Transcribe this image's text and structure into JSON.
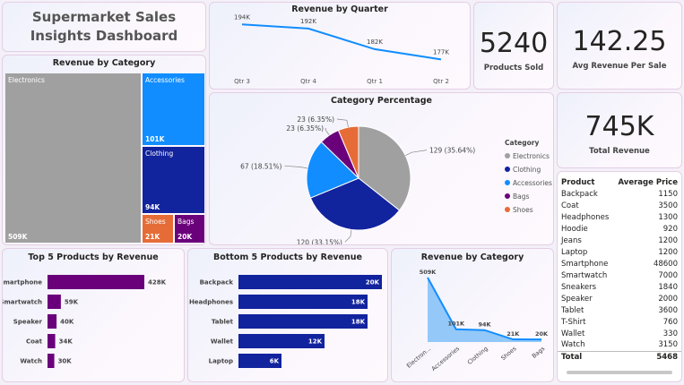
{
  "title": "Supermarket Sales Insights Dashboard",
  "kpis": {
    "products_sold": {
      "value": "5240",
      "label": "Products Sold"
    },
    "avg_revenue": {
      "value": "142.25",
      "label": "Avg Revenue Per Sale"
    },
    "total_revenue": {
      "value": "745K",
      "label": "Total Revenue"
    }
  },
  "colors": {
    "purple": "#6b007b",
    "navy": "#12239e",
    "grey": "#a0a0a0",
    "blue": "#118dff",
    "orange": "#e66c37",
    "light_blue": "#93c8f8"
  },
  "chart_data": [
    {
      "id": "revenue_by_quarter",
      "type": "line",
      "title": "Revenue by Quarter",
      "categories": [
        "Qtr 3",
        "Qtr 4",
        "Qtr 1",
        "Qtr 2"
      ],
      "values": [
        194,
        192,
        182,
        177
      ],
      "labels": [
        "194K",
        "192K",
        "182K",
        "177K"
      ]
    },
    {
      "id": "revenue_by_category_treemap",
      "type": "treemap",
      "title": "Revenue by Category",
      "items": [
        {
          "name": "Electronics",
          "value": 509,
          "label": "509K",
          "color": "#a0a0a0"
        },
        {
          "name": "Accessories",
          "value": 101,
          "label": "101K",
          "color": "#118dff"
        },
        {
          "name": "Clothing",
          "value": 94,
          "label": "94K",
          "color": "#12239e"
        },
        {
          "name": "Shoes",
          "value": 21,
          "label": "21K",
          "color": "#e66c37"
        },
        {
          "name": "Bags",
          "value": 20,
          "label": "20K",
          "color": "#6b007b"
        }
      ]
    },
    {
      "id": "category_percentage",
      "type": "pie",
      "title": "Category Percentage",
      "legend_title": "Category",
      "slices": [
        {
          "name": "Electronics",
          "value": 129,
          "label": "129 (35.64%)",
          "color": "#a0a0a0"
        },
        {
          "name": "Clothing",
          "value": 120,
          "label": "120 (33.15%)",
          "color": "#12239e"
        },
        {
          "name": "Accessories",
          "value": 67,
          "label": "67 (18.51%)",
          "color": "#118dff"
        },
        {
          "name": "Bags",
          "value": 23,
          "label": "23 (6.35%)",
          "color": "#6b007b"
        },
        {
          "name": "Shoes",
          "value": 23,
          "label": "23 (6.35%)",
          "color": "#e66c37"
        }
      ]
    },
    {
      "id": "top5_products",
      "type": "bar",
      "title": "Top 5 Products by Revenue",
      "categories": [
        "Smartphone",
        "Smartwatch",
        "Speaker",
        "Coat",
        "Watch"
      ],
      "values": [
        428,
        59,
        40,
        34,
        30
      ],
      "labels": [
        "428K",
        "59K",
        "40K",
        "34K",
        "30K"
      ],
      "color": "#6b007b"
    },
    {
      "id": "bottom5_products",
      "type": "bar",
      "title": "Bottom 5 Products by Revenue",
      "categories": [
        "Backpack",
        "Headphones",
        "Tablet",
        "Wallet",
        "Laptop"
      ],
      "values": [
        20,
        18,
        18,
        12,
        6
      ],
      "labels": [
        "20K",
        "18K",
        "18K",
        "12K",
        "6K"
      ],
      "color": "#12239e"
    },
    {
      "id": "revenue_by_category_area",
      "type": "area",
      "title": "Revenue by Category",
      "categories": [
        "Electron...",
        "Accessories",
        "Clothing",
        "Shoes",
        "Bags"
      ],
      "values": [
        509,
        101,
        94,
        21,
        20
      ],
      "labels": [
        "509K",
        "101K",
        "94K",
        "21K",
        "20K"
      ]
    }
  ],
  "table": {
    "headers": [
      "Product",
      "Average Price"
    ],
    "rows": [
      [
        "Backpack",
        "1150"
      ],
      [
        "Coat",
        "3500"
      ],
      [
        "Headphones",
        "1300"
      ],
      [
        "Hoodie",
        "920"
      ],
      [
        "Jeans",
        "1200"
      ],
      [
        "Laptop",
        "1200"
      ],
      [
        "Smartphone",
        "48600"
      ],
      [
        "Smartwatch",
        "7000"
      ],
      [
        "Sneakers",
        "1840"
      ],
      [
        "Speaker",
        "2000"
      ],
      [
        "Tablet",
        "3600"
      ],
      [
        "T-Shirt",
        "760"
      ],
      [
        "Wallet",
        "330"
      ],
      [
        "Watch",
        "3150"
      ]
    ],
    "total": [
      "Total",
      "5468"
    ]
  }
}
